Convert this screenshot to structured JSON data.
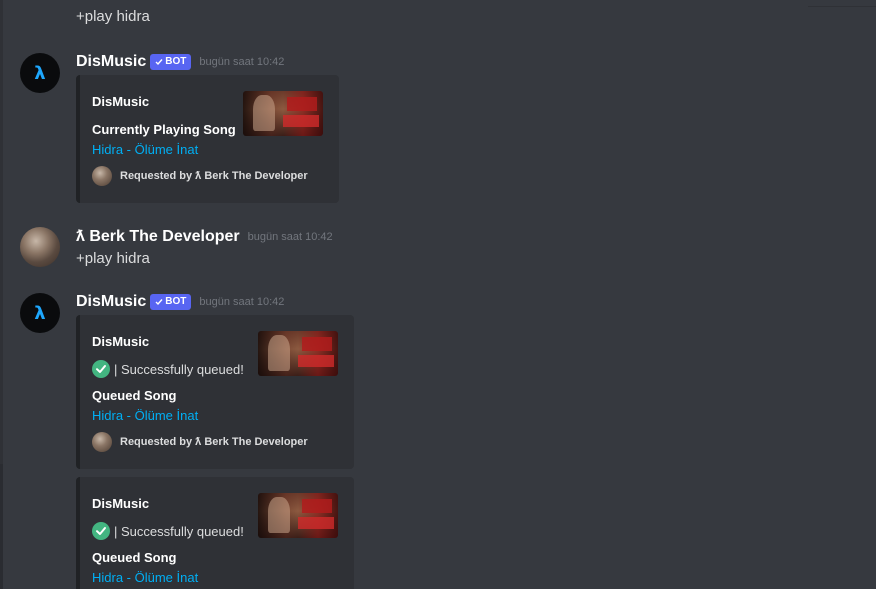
{
  "colors": {
    "background": "#36393f",
    "embed_background": "#2f3136",
    "link": "#00aff4",
    "bot_tag": "#5865f2",
    "check": "#43b581"
  },
  "top_message": {
    "text": "+play hidra"
  },
  "messages": [
    {
      "author": "DisMusic",
      "bot_tag": "BOT",
      "timestamp": "bugün saat 10:42",
      "avatar_icon": "lambda-logo-icon",
      "avatar_glyph": "λ",
      "embeds": [
        {
          "author": "DisMusic",
          "field_name": "Currently Playing Song",
          "field_value": "Hidra - Ölüme İnat",
          "footer": "Requested by ƛ Berk The Developer"
        }
      ]
    },
    {
      "author": "ƛ Berk The Developer",
      "timestamp": "bugün saat 10:42",
      "text": "+play hidra"
    },
    {
      "author": "DisMusic",
      "bot_tag": "BOT",
      "timestamp": "bugün saat 10:42",
      "avatar_glyph": "λ",
      "embeds": [
        {
          "author": "DisMusic",
          "description": "| Successfully queued!",
          "field_name": "Queued Song",
          "field_value": "Hidra - Ölüme İnat",
          "footer": "Requested by ƛ Berk The Developer"
        },
        {
          "author": "DisMusic",
          "description": "| Successfully queued!",
          "field_name": "Queued Song",
          "field_value": "Hidra - Ölüme İnat"
        }
      ]
    }
  ]
}
